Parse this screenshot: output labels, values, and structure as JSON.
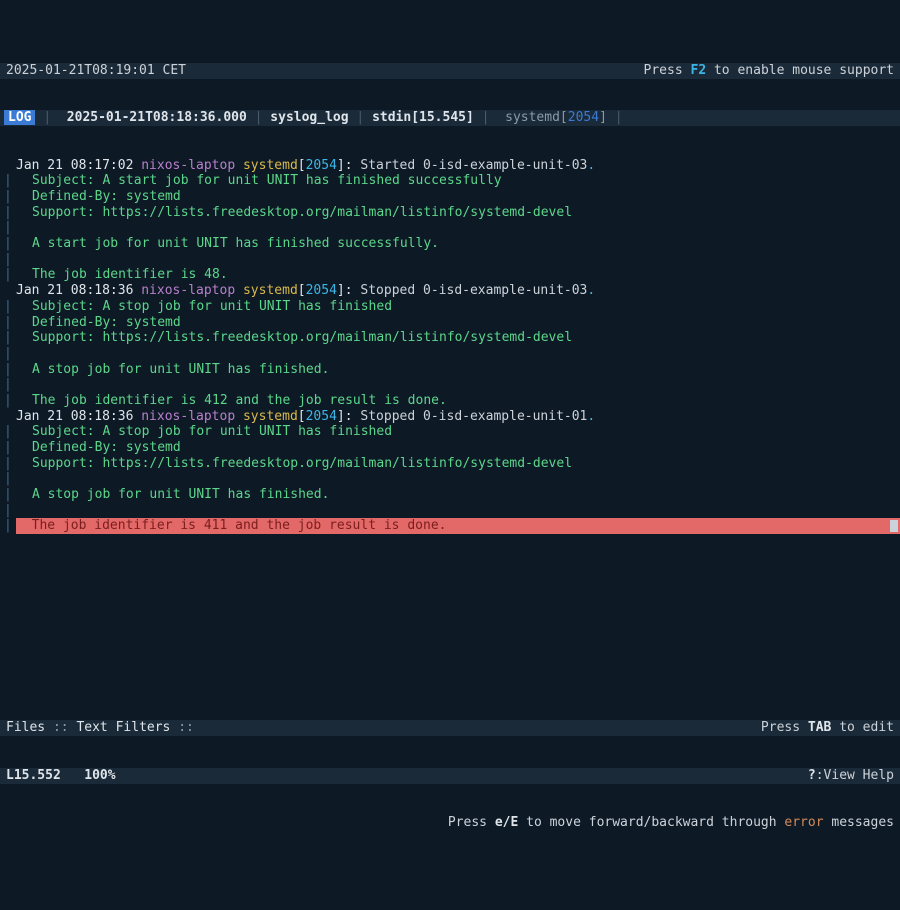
{
  "topbar": {
    "timestamp": "2025-01-21T08:19:01 CET",
    "hint_prefix": "Press ",
    "hint_key": "F2",
    "hint_suffix": " to enable mouse support"
  },
  "tabbar": {
    "log_badge": "LOG",
    "timestamp": "2025-01-21T08:18:36.000",
    "source": "syslog_log",
    "stdin": "stdin[15.545]",
    "proc_name": "systemd",
    "proc_open": "[",
    "proc_pid": "2054",
    "proc_close": "]"
  },
  "logs": [
    {
      "type": "hdr",
      "ts": "Jan 21 08:17:02",
      "host": "nixos-laptop",
      "unit": "systemd",
      "pid": "2054",
      "msg": "Started 0-isd-example-unit-03",
      "tail": "."
    },
    {
      "type": "body",
      "text": "Subject: A start job for unit UNIT has finished successfully"
    },
    {
      "type": "body",
      "text": "Defined-By: systemd"
    },
    {
      "type": "body",
      "text": "Support: https://lists.freedesktop.org/mailman/listinfo/systemd-devel"
    },
    {
      "type": "blank"
    },
    {
      "type": "body",
      "text": "A start job for unit UNIT has finished successfully."
    },
    {
      "type": "blank"
    },
    {
      "type": "body",
      "text": "The job identifier is 48."
    },
    {
      "type": "hdr",
      "ts": "Jan 21 08:18:36",
      "host": "nixos-laptop",
      "unit": "systemd",
      "pid": "2054",
      "msg": "Stopped 0-isd-example-unit-03",
      "tail": "."
    },
    {
      "type": "body",
      "text": "Subject: A stop job for unit UNIT has finished"
    },
    {
      "type": "body",
      "text": "Defined-By: systemd"
    },
    {
      "type": "body",
      "text": "Support: https://lists.freedesktop.org/mailman/listinfo/systemd-devel"
    },
    {
      "type": "blank"
    },
    {
      "type": "body",
      "text": "A stop job for unit UNIT has finished."
    },
    {
      "type": "blank"
    },
    {
      "type": "body",
      "text": "The job identifier is 412 and the job result is done."
    },
    {
      "type": "hdr",
      "ts": "Jan 21 08:18:36",
      "host": "nixos-laptop",
      "unit": "systemd",
      "pid": "2054",
      "msg": "Stopped 0-isd-example-unit-01",
      "tail": "."
    },
    {
      "type": "body",
      "text": "Subject: A stop job for unit UNIT has finished"
    },
    {
      "type": "body",
      "text": "Defined-By: systemd"
    },
    {
      "type": "body",
      "text": "Support: https://lists.freedesktop.org/mailman/listinfo/systemd-devel"
    },
    {
      "type": "blank"
    },
    {
      "type": "body",
      "text": "A stop job for unit UNIT has finished."
    },
    {
      "type": "blank"
    },
    {
      "type": "highlight",
      "text": "  The job identifier is 411 and the job result is done."
    }
  ],
  "status1": {
    "left_files": "Files",
    "left_sep": " :: ",
    "left_filters": "Text Filters",
    "left_tail": " ::",
    "right_prefix": "Press ",
    "right_key": "TAB",
    "right_suffix": " to edit"
  },
  "status2": {
    "pos": "L15.552",
    "pct": "100%",
    "help_key": "?",
    "help_sep": ":",
    "help_text": "View Help"
  },
  "hint": {
    "prefix": "Press ",
    "keys": "e/E",
    "mid": " to move forward/backward through ",
    "err": "error",
    "suffix": " messages"
  }
}
